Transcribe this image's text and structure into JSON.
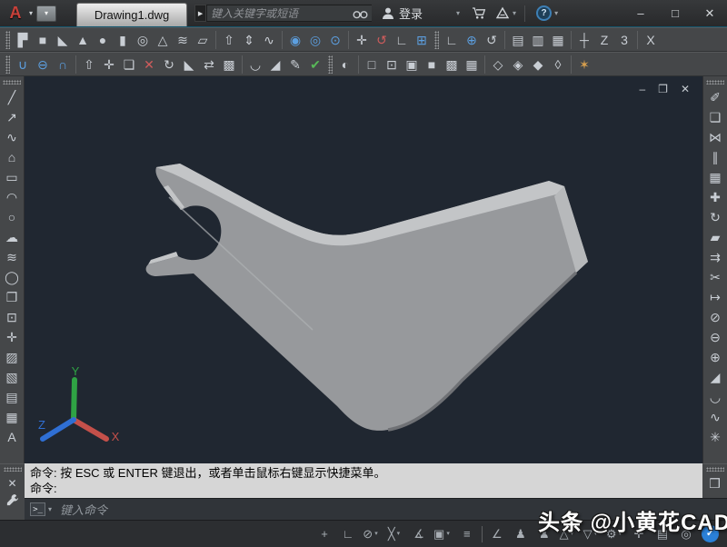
{
  "titlebar": {
    "logo_letter": "A",
    "tab": "Drawing1.dwg",
    "search_placeholder": "键入关键字或短语",
    "login_label": "登录",
    "help_glyph": "?",
    "minimize_glyph": "–",
    "maximize_glyph": "□",
    "close_glyph": "✕"
  },
  "ui": {
    "caret": "▾",
    "play": "▶"
  },
  "toolbar_row1": [
    {
      "grip": true
    },
    {
      "n": "polysolid-icon",
      "g": "▛"
    },
    {
      "n": "box-icon",
      "g": "■"
    },
    {
      "n": "wedge-icon",
      "g": "◣"
    },
    {
      "n": "cone-icon",
      "g": "▲"
    },
    {
      "n": "sphere-icon",
      "g": "●"
    },
    {
      "n": "cylinder-icon",
      "g": "▮"
    },
    {
      "n": "torus-icon",
      "g": "◎"
    },
    {
      "n": "pyramid-icon",
      "g": "△"
    },
    {
      "n": "helix-icon",
      "g": "≋"
    },
    {
      "n": "planar-surface-icon",
      "g": "▱"
    },
    {
      "sep": true
    },
    {
      "n": "extrude-icon",
      "g": "⇧"
    },
    {
      "n": "presspull-icon",
      "g": "⇕"
    },
    {
      "n": "sweep-icon",
      "g": "∿"
    },
    {
      "sep": true
    },
    {
      "n": "subobject-no-filter-icon",
      "g": "◉",
      "c": "blue"
    },
    {
      "n": "subobject-vertex-filter-icon",
      "g": "◎",
      "c": "blue"
    },
    {
      "n": "subobject-edge-filter-icon",
      "g": "⊙",
      "c": "blue"
    },
    {
      "sep": true
    },
    {
      "n": "move-gizmo-icon",
      "g": "✛"
    },
    {
      "n": "rotate-gizmo-icon",
      "g": "↺",
      "c": "red"
    },
    {
      "n": "scale-gizmo-icon",
      "g": "∟"
    },
    {
      "n": "3d-array-icon",
      "g": "⊞",
      "c": "blue"
    },
    {
      "grip": true
    },
    {
      "n": "ucs-icon",
      "g": "∟"
    },
    {
      "n": "ucs-world-icon",
      "g": "⊕",
      "c": "blue"
    },
    {
      "n": "ucs-previous-icon",
      "g": "↺"
    },
    {
      "sep": true
    },
    {
      "n": "ucs-face-icon",
      "g": "▤"
    },
    {
      "n": "ucs-object-icon",
      "g": "▥"
    },
    {
      "n": "ucs-view-icon",
      "g": "▦"
    },
    {
      "sep": true
    },
    {
      "n": "ucs-origin-icon",
      "g": "┼"
    },
    {
      "n": "ucs-z-axis-icon",
      "g": "Z"
    },
    {
      "n": "ucs-3point-icon",
      "g": "3"
    },
    {
      "sep": true
    },
    {
      "n": "ucs-rotate-x-icon",
      "g": "X"
    }
  ],
  "toolbar_row2": [
    {
      "grip": true
    },
    {
      "n": "union-icon",
      "g": "∪",
      "c": "blue"
    },
    {
      "n": "subtract-icon",
      "g": "⊖",
      "c": "blue"
    },
    {
      "n": "intersect-icon",
      "g": "∩",
      "c": "blue"
    },
    {
      "sep": true
    },
    {
      "n": "extrude-faces-icon",
      "g": "⇧"
    },
    {
      "n": "move-faces-icon",
      "g": "✛"
    },
    {
      "n": "offset-faces-icon",
      "g": "❏"
    },
    {
      "n": "delete-faces-icon",
      "g": "✕",
      "c": "red"
    },
    {
      "n": "rotate-faces-icon",
      "g": "↻"
    },
    {
      "n": "taper-faces-icon",
      "g": "◣"
    },
    {
      "n": "copy-faces-icon",
      "g": "⇄"
    },
    {
      "n": "color-faces-icon",
      "g": "▩"
    },
    {
      "sep": true
    },
    {
      "n": "fillet-edge-icon",
      "g": "◡"
    },
    {
      "n": "chamfer-edge-icon",
      "g": "◢"
    },
    {
      "n": "imprint-icon",
      "g": "✎"
    },
    {
      "n": "clean-icon",
      "g": "✔",
      "c": "green"
    },
    {
      "grip": true
    },
    {
      "n": "visual-styles-manager-icon",
      "g": "◐"
    },
    {
      "sep": true
    },
    {
      "n": "vs-2d-wireframe-icon",
      "g": "□"
    },
    {
      "n": "vs-wireframe-icon",
      "g": "⊡"
    },
    {
      "n": "vs-hidden-icon",
      "g": "▣"
    },
    {
      "n": "vs-realistic-icon",
      "g": "■"
    },
    {
      "n": "vs-conceptual-icon",
      "g": "▩"
    },
    {
      "n": "vs-shaded-icon",
      "g": "▦"
    },
    {
      "sep": true
    },
    {
      "n": "view-sw-isometric-icon",
      "g": "◇"
    },
    {
      "n": "view-se-isometric-icon",
      "g": "◈"
    },
    {
      "n": "view-ne-isometric-icon",
      "g": "◆"
    },
    {
      "n": "view-nw-isometric-icon",
      "g": "◊"
    },
    {
      "sep": true
    },
    {
      "n": "render-icon",
      "g": "✶",
      "c": "orange"
    }
  ],
  "draw_toolbar": [
    {
      "grip": true
    },
    {
      "n": "line-icon",
      "g": "╱"
    },
    {
      "n": "construction-line-icon",
      "g": "↗"
    },
    {
      "n": "polyline-icon",
      "g": "∿"
    },
    {
      "n": "polygon-icon",
      "g": "⌂"
    },
    {
      "n": "rectangle-icon",
      "g": "▭"
    },
    {
      "n": "arc-icon",
      "g": "◠"
    },
    {
      "n": "circle-icon",
      "g": "○"
    },
    {
      "n": "revision-cloud-icon",
      "g": "☁"
    },
    {
      "n": "spline-icon",
      "g": "≋"
    },
    {
      "n": "ellipse-icon",
      "g": "◯"
    },
    {
      "n": "insert-block-icon",
      "g": "❐"
    },
    {
      "n": "create-block-icon",
      "g": "⊡"
    },
    {
      "n": "point-icon",
      "g": "✛"
    },
    {
      "n": "hatch-icon",
      "g": "▨"
    },
    {
      "n": "gradient-icon",
      "g": "▧"
    },
    {
      "n": "region-icon",
      "g": "▤"
    },
    {
      "n": "table-icon",
      "g": "▦"
    },
    {
      "n": "mtext-icon",
      "g": "A"
    }
  ],
  "modify_toolbar": [
    {
      "grip": true
    },
    {
      "n": "erase-icon",
      "g": "✐"
    },
    {
      "n": "copy-icon",
      "g": "❏"
    },
    {
      "n": "mirror-icon",
      "g": "⋈"
    },
    {
      "n": "offset-icon",
      "g": "∥"
    },
    {
      "n": "array-icon",
      "g": "▦"
    },
    {
      "n": "move-icon",
      "g": "✚"
    },
    {
      "n": "rotate-icon",
      "g": "↻"
    },
    {
      "n": "scale-icon",
      "g": "▰"
    },
    {
      "n": "stretch-icon",
      "g": "⇉"
    },
    {
      "n": "trim-icon",
      "g": "✂"
    },
    {
      "n": "extend-icon",
      "g": "↦"
    },
    {
      "n": "break-icon",
      "g": "⊘"
    },
    {
      "n": "break-at-point-icon",
      "g": "⊖"
    },
    {
      "n": "join-icon",
      "g": "⊕"
    },
    {
      "n": "chamfer-icon",
      "g": "◢"
    },
    {
      "n": "fillet-icon",
      "g": "◡"
    },
    {
      "n": "blend-curves-icon",
      "g": "∿"
    },
    {
      "n": "explode-icon",
      "g": "✳"
    }
  ],
  "extra_toolbar": [
    {
      "grip": true
    },
    {
      "n": "docked-toolbar-icon",
      "g": "❒"
    }
  ],
  "viewport": {
    "minimize_glyph": "–",
    "restore_glyph": "❐",
    "close_glyph": "✕"
  },
  "ucs": {
    "x_label": "X",
    "y_label": "Y",
    "z_label": "Z",
    "x_color": "#c4504a",
    "y_color": "#2fa344",
    "z_color": "#2f6fd4"
  },
  "solid": {
    "face": "#97999c",
    "bevel": "#c3c5c7",
    "right_bevel": "#b7b9bb",
    "edge_dark": "#6f7175"
  },
  "command": {
    "history_line1": "命令:  按 ESC 或 ENTER 键退出，或者单击鼠标右键显示快捷菜单。",
    "history_line2": "命令:",
    "prompt_badge": ">_",
    "input_placeholder": "键入命令",
    "close_glyph": "✕"
  },
  "statusbar": [
    {
      "n": "dynamic-input-icon",
      "g": "+"
    },
    {
      "n": "ortho-mode-icon",
      "g": "∟",
      "c": "blue"
    },
    {
      "n": "polar-tracking-icon",
      "g": "⊘",
      "caret": true
    },
    {
      "n": "isometric-drafting-icon",
      "g": "╳",
      "caret": true
    },
    {
      "n": "object-snap-tracking-icon",
      "g": "∡",
      "c": "blue"
    },
    {
      "n": "object-snap-icon",
      "g": "▣",
      "c": "blue",
      "caret": true
    },
    {
      "n": "lineweight-icon",
      "g": "≡"
    },
    {
      "sep": true
    },
    {
      "n": "dynamic-ucs-icon",
      "g": "∠"
    },
    {
      "n": "annotation-monitor-icon",
      "g": "♟",
      "c": "blue"
    },
    {
      "n": "auto-annotation-icon",
      "g": "♟"
    },
    {
      "n": "annotation-visibility-icon",
      "g": "△",
      "caret": true
    },
    {
      "n": "annotation-scale-icon",
      "g": "▽",
      "caret": true
    },
    {
      "n": "workspace-switching-icon",
      "g": "⚙",
      "caret": true
    },
    {
      "n": "clean-screen-icon",
      "g": "✛"
    },
    {
      "n": "quick-properties-icon",
      "g": "▤"
    },
    {
      "n": "isolate-objects-icon",
      "g": "◎"
    },
    {
      "n": "customization-icon",
      "g": "✓",
      "kind": "circle"
    }
  ],
  "watermark": "头条 @小黄花CAD",
  "colors": {
    "titlebar_bg": "#2b2d2f",
    "toolbar_bg": "#454749",
    "drawing_bg": "#202731",
    "command_history_bg": "#d6d6d6",
    "statusbar_bg": "#2c2e31",
    "accent_blue": "#5c9fe0"
  }
}
